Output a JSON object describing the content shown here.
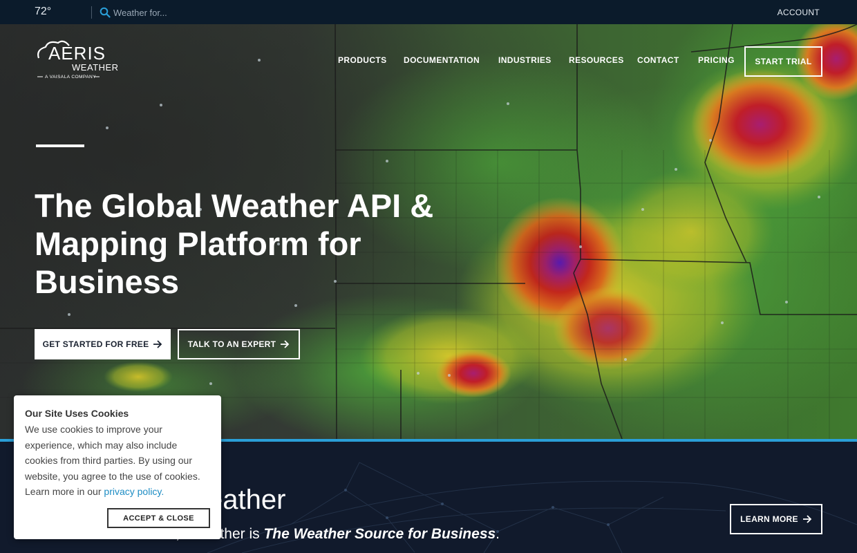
{
  "topbar": {
    "temperature": "72°",
    "search_placeholder": "Weather for...",
    "account_label": "ACCOUNT"
  },
  "brand": {
    "logo_line1": "AERIS",
    "logo_line2": "WEATHER",
    "logo_tagline": "A VAISALA COMPANY"
  },
  "nav": {
    "items": [
      {
        "label": "PRODUCTS"
      },
      {
        "label": "DOCUMENTATION"
      },
      {
        "label": "INDUSTRIES"
      },
      {
        "label": "RESOURCES"
      },
      {
        "label": "CONTACT"
      },
      {
        "label": "PRICING"
      }
    ],
    "cta_label": "START TRIAL"
  },
  "hero": {
    "title": "The Global Weather API & Mapping Platform for Business",
    "primary_button": "GET STARTED FOR FREE",
    "secondary_button": "TALK TO AN EXPERT"
  },
  "lower": {
    "heading_visible": "eather",
    "subtitle_prefix_visible": "From data to software, Xweather is ",
    "subtitle_emphasis": "The Weather Source for Business",
    "subtitle_suffix": ".",
    "learn_more": "LEARN MORE"
  },
  "cookie": {
    "title": "Our Site Uses Cookies",
    "body": "We use cookies to improve your experience, which may also include cookies from third parties. By using our website, you agree to the use of cookies. Learn more in our ",
    "link_text": "privacy policy",
    "link_suffix": ".",
    "accept_label": "ACCEPT & CLOSE"
  },
  "colors": {
    "topbar_bg": "#0b1b2b",
    "accent_blue": "#2a9fd8",
    "lower_bg": "#111a2c",
    "link_blue": "#1e8dc4"
  }
}
